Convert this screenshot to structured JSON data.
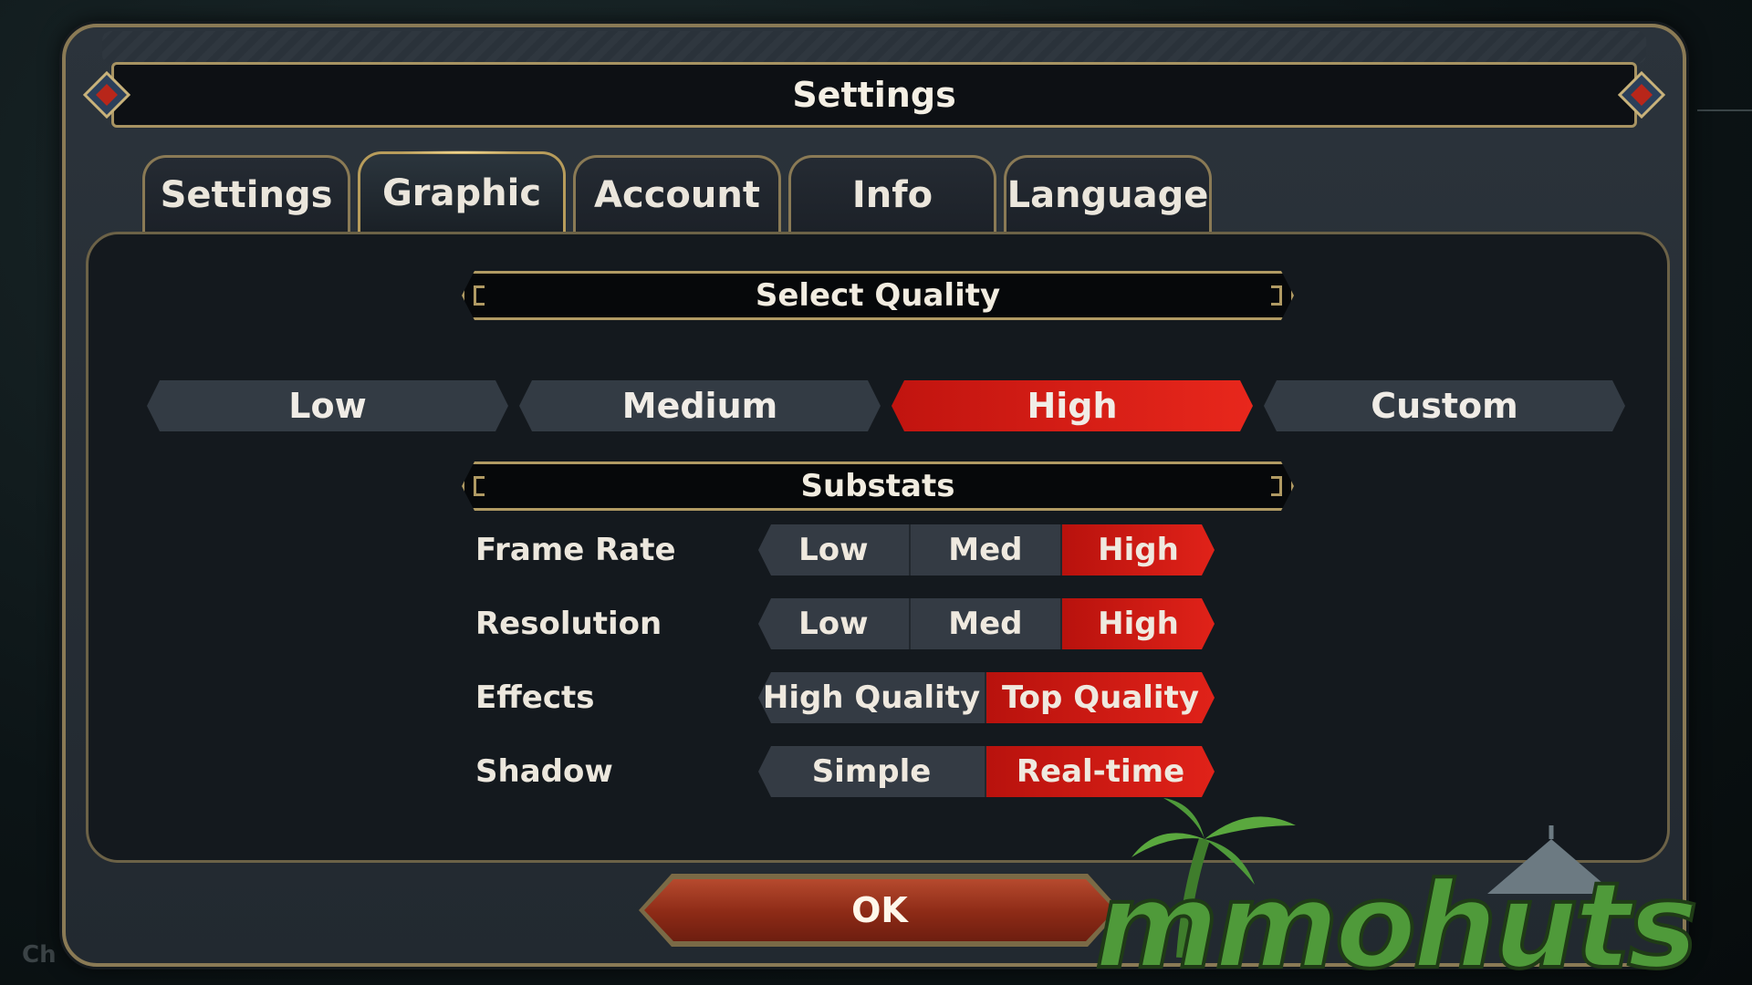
{
  "background": {
    "hint_text": "Ch"
  },
  "window": {
    "title": "Settings"
  },
  "tabs": [
    {
      "label": "Settings",
      "active": false
    },
    {
      "label": "Graphic",
      "active": true
    },
    {
      "label": "Account",
      "active": false
    },
    {
      "label": "Info",
      "active": false
    },
    {
      "label": "Language",
      "active": false
    }
  ],
  "quality": {
    "header": "Select Quality",
    "options": [
      "Low",
      "Medium",
      "High",
      "Custom"
    ],
    "selected": "High"
  },
  "substats": {
    "header": "Substats",
    "rows": [
      {
        "label": "Frame Rate",
        "options": [
          "Low",
          "Med",
          "High"
        ],
        "selected": "High"
      },
      {
        "label": "Resolution",
        "options": [
          "Low",
          "Med",
          "High"
        ],
        "selected": "High"
      },
      {
        "label": "Effects",
        "options": [
          "High Quality",
          "Top Quality"
        ],
        "selected": "Top Quality"
      },
      {
        "label": "Shadow",
        "options": [
          "Simple",
          "Real-time"
        ],
        "selected": "Real-time"
      }
    ]
  },
  "ok_button": {
    "label": "OK"
  },
  "watermark": {
    "text": "mmohuts",
    "icon": "palm-tree-icon"
  },
  "colors": {
    "selected_red": "#e02219",
    "gold_border": "#b09a63",
    "panel_bg": "#14191e",
    "option_bg": "#343b44",
    "ok_red": "#8c2a16",
    "logo_green": "#4f9a3a"
  }
}
